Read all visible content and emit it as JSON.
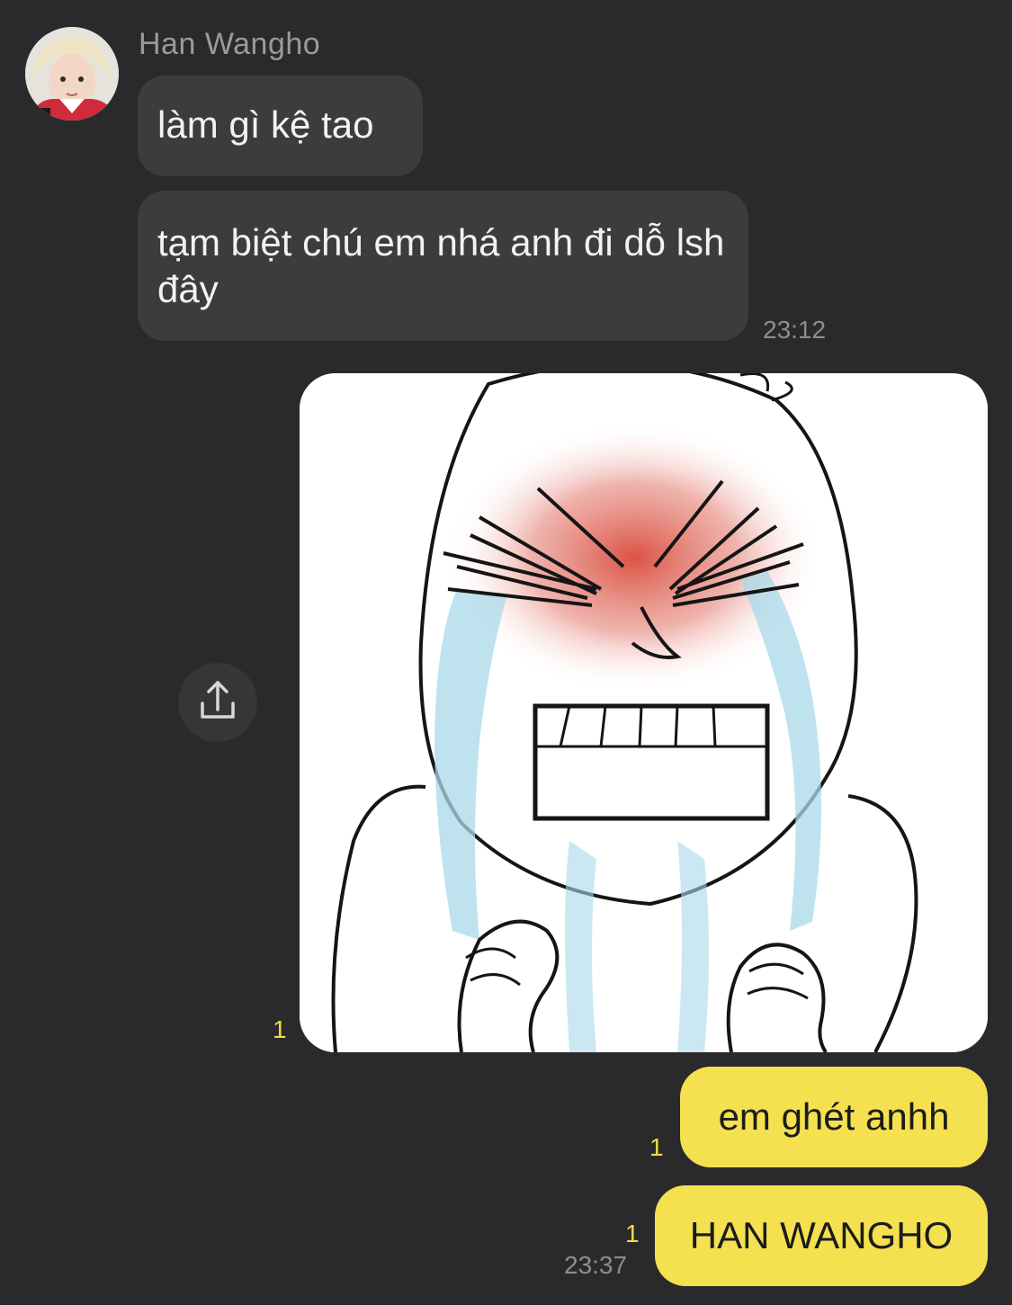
{
  "conversation": {
    "sender_name": "Han Wangho",
    "incoming": [
      {
        "text": "làm gì kệ tao"
      },
      {
        "text": "tạm biệt chú em nhá anh đi dỗ lsh đây"
      }
    ],
    "incoming_time": "23:12",
    "image_unread": "1",
    "outgoing": [
      {
        "text": "em ghét anhh",
        "unread": "1"
      },
      {
        "text": "HAN WANGHO",
        "unread": "1"
      }
    ],
    "outgoing_time": "23:37"
  },
  "icons": {
    "share": "share-icon",
    "avatar": "avatar-photo"
  },
  "colors": {
    "background": "#2a2a2c",
    "incoming_bubble": "#3c3c3e",
    "outgoing_bubble": "#f5e14f",
    "unread_count": "#f1dc3e"
  }
}
